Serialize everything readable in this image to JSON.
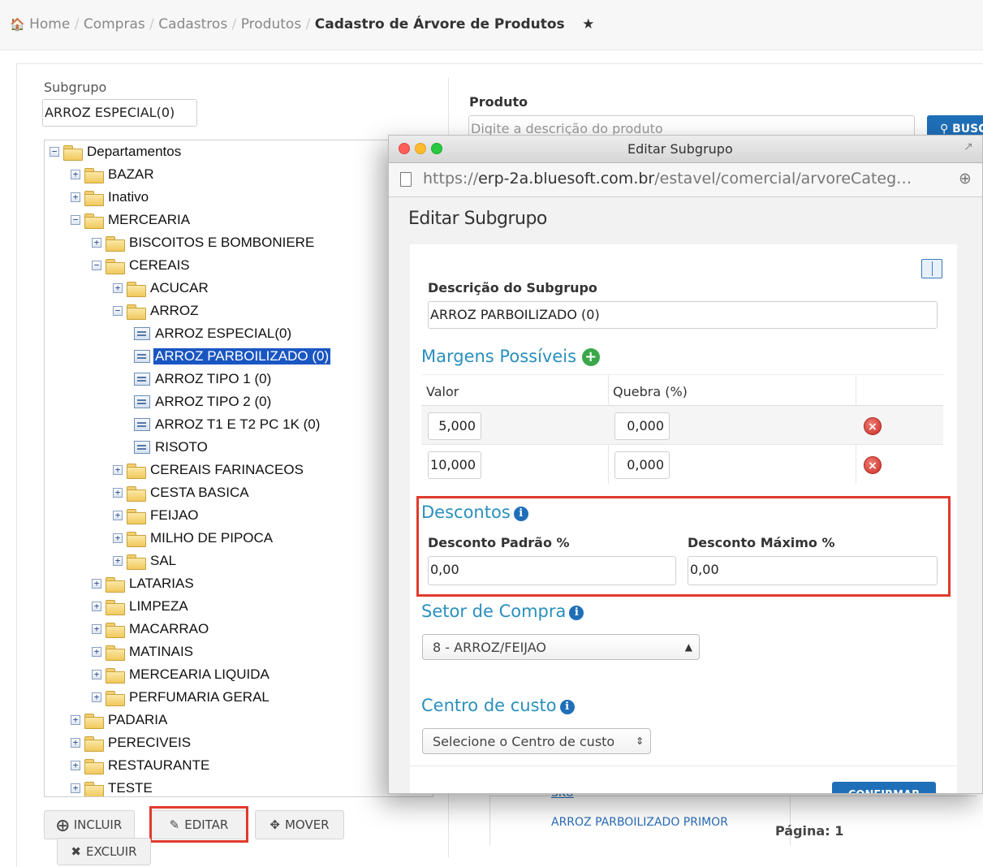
{
  "breadcrumb": {
    "items": [
      "Home",
      "Compras",
      "Cadastros",
      "Produtos"
    ],
    "current": "Cadastro de Árvore de Produtos"
  },
  "subgrupo": {
    "label": "Subgrupo",
    "value": "ARROZ ESPECIAL(0)"
  },
  "tree": {
    "nodes": [
      {
        "label": "Departamentos",
        "level": 0,
        "type": "folder-open",
        "toggle": "−"
      },
      {
        "label": "BAZAR",
        "level": 1,
        "type": "folder",
        "toggle": "+"
      },
      {
        "label": "Inativo",
        "level": 1,
        "type": "folder",
        "toggle": "+"
      },
      {
        "label": "MERCEARIA",
        "level": 1,
        "type": "folder-open",
        "toggle": "−"
      },
      {
        "label": "BISCOITOS E BOMBONIERE",
        "level": 2,
        "type": "folder",
        "toggle": "+"
      },
      {
        "label": "CEREAIS",
        "level": 2,
        "type": "folder-open",
        "toggle": "−"
      },
      {
        "label": "ACUCAR",
        "level": 3,
        "type": "folder",
        "toggle": "+"
      },
      {
        "label": "ARROZ",
        "level": 3,
        "type": "folder-open",
        "toggle": "−"
      },
      {
        "label": "ARROZ ESPECIAL(0)",
        "level": 4,
        "type": "leaf"
      },
      {
        "label": "ARROZ PARBOILIZADO (0)",
        "level": 4,
        "type": "leaf",
        "selected": true
      },
      {
        "label": "ARROZ TIPO 1 (0)",
        "level": 4,
        "type": "leaf"
      },
      {
        "label": "ARROZ TIPO 2 (0)",
        "level": 4,
        "type": "leaf"
      },
      {
        "label": "ARROZ T1 E T2 PC 1K (0)",
        "level": 4,
        "type": "leaf"
      },
      {
        "label": "RISOTO",
        "level": 4,
        "type": "leaf"
      },
      {
        "label": "CEREAIS FARINACEOS",
        "level": 3,
        "type": "folder",
        "toggle": "+"
      },
      {
        "label": "CESTA BASICA",
        "level": 3,
        "type": "folder",
        "toggle": "+"
      },
      {
        "label": "FEIJAO",
        "level": 3,
        "type": "folder",
        "toggle": "+"
      },
      {
        "label": "MILHO DE PIPOCA",
        "level": 3,
        "type": "folder",
        "toggle": "+"
      },
      {
        "label": "SAL",
        "level": 3,
        "type": "folder",
        "toggle": "+"
      },
      {
        "label": "LATARIAS",
        "level": 2,
        "type": "folder",
        "toggle": "+"
      },
      {
        "label": "LIMPEZA",
        "level": 2,
        "type": "folder",
        "toggle": "+"
      },
      {
        "label": "MACARRAO",
        "level": 2,
        "type": "folder",
        "toggle": "+"
      },
      {
        "label": "MATINAIS",
        "level": 2,
        "type": "folder",
        "toggle": "+"
      },
      {
        "label": "MERCEARIA LIQUIDA",
        "level": 2,
        "type": "folder",
        "toggle": "+"
      },
      {
        "label": "PERFUMARIA GERAL",
        "level": 2,
        "type": "folder",
        "toggle": "+"
      },
      {
        "label": "PADARIA",
        "level": 1,
        "type": "folder",
        "toggle": "+"
      },
      {
        "label": "PERECIVEIS",
        "level": 1,
        "type": "folder",
        "toggle": "+"
      },
      {
        "label": "RESTAURANTE",
        "level": 1,
        "type": "folder",
        "toggle": "+"
      },
      {
        "label": "TESTE",
        "level": 1,
        "type": "folder",
        "toggle": "+"
      }
    ]
  },
  "buttons": {
    "incluir": "INCLUIR",
    "editar": "EDITAR",
    "mover": "MOVER",
    "excluir": "EXCLUIR"
  },
  "produto": {
    "label": "Produto",
    "placeholder": "Digite a descrição do produto",
    "search_button": "BUSC",
    "pagina_label": "Página: 1",
    "row_partial_1": "ARROZ PARBOILIZADO PRIMOR",
    "row_partial_2": "SKU"
  },
  "modal": {
    "window_title": "Editar Subgrupo",
    "url_domain": "erp-2a.bluesoft.com.br",
    "url_prefix": "https://",
    "url_path": "/estavel/comercial/arvoreCateg…",
    "heading": "Editar Subgrupo",
    "descricao_label": "Descrição do Subgrupo",
    "descricao_value": "ARROZ PARBOILIZADO (0)",
    "margens_title": "Margens Possíveis",
    "margens_headers": [
      "Valor",
      "Quebra (%)"
    ],
    "margens_rows": [
      {
        "valor": "5,000",
        "quebra": "0,000"
      },
      {
        "valor": "10,000",
        "quebra": "0,000"
      }
    ],
    "descontos_title": "Descontos",
    "desconto_padrao_label": "Desconto Padrão %",
    "desconto_padrao_value": "0,00",
    "desconto_maximo_label": "Desconto Máximo %",
    "desconto_maximo_value": "0,00",
    "setor_title": "Setor de Compra",
    "setor_value": "8 - ARROZ/FEIJAO",
    "centro_title": "Centro de custo",
    "centro_value": "Selecione o Centro de custo",
    "confirm_button": "CONFIRMAR"
  },
  "colors": {
    "accent": "#2a8fbd",
    "highlight": "#e03a2c",
    "selection": "#1a56c2",
    "primary_button": "#1f6fb8"
  }
}
